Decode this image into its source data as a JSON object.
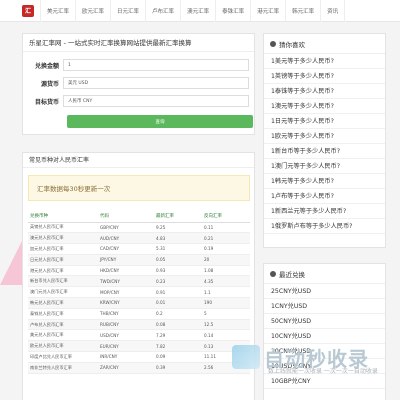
{
  "nav": {
    "logo": "汇",
    "items": [
      "美元汇率",
      "欧元汇率",
      "日元汇率",
      "卢布汇率",
      "澳元汇率",
      "泰铢汇率",
      "港元汇率",
      "韩元汇率",
      "资讯"
    ]
  },
  "converter": {
    "title": "乐星汇率网 - 一站式实时汇率换算网站提供最新汇率换算",
    "amount_label": "兑换金额",
    "amount_value": "1",
    "source_label": "源货币",
    "source_value": "美元 USD",
    "target_label": "目标货币",
    "target_value": "人民币 CNY",
    "button": "查询"
  },
  "rates": {
    "title": "常见币种对人民币汇率",
    "notice": "汇率数据每30秒更新一次",
    "headers": [
      "兑换币种",
      "代码",
      "最新汇率",
      "反向汇率"
    ],
    "rows": [
      [
        "英镑兑人民币汇率",
        "GBP/CNY",
        "9.25",
        "0.11"
      ],
      [
        "澳元兑人民币汇率",
        "AUD/CNY",
        "4.83",
        "0.21"
      ],
      [
        "加元兑人民币汇率",
        "CAD/CNY",
        "5.31",
        "0.19"
      ],
      [
        "日元兑人民币汇率",
        "JPY/CNY",
        "0.05",
        "20"
      ],
      [
        "港元兑人民币汇率",
        "HKD/CNY",
        "0.93",
        "1.08"
      ],
      [
        "新台币兑人民币汇率",
        "TWD/CNY",
        "0.23",
        "4.35"
      ],
      [
        "澳门元兑人民币汇率",
        "MOP/CNY",
        "0.91",
        "1.1"
      ],
      [
        "韩元兑人民币汇率",
        "KRW/CNY",
        "0.01",
        "190"
      ],
      [
        "泰铢兑人民币汇率",
        "THB/CNY",
        "0.2",
        "5"
      ],
      [
        "卢布兑人民币汇率",
        "RUB/CNY",
        "0.08",
        "12.5"
      ],
      [
        "美元兑人民币汇率",
        "USD/CNY",
        "7.29",
        "0.14"
      ],
      [
        "欧元兑人民币汇率",
        "EUR/CNY",
        "7.82",
        "0.13"
      ],
      [
        "印度卢比兑人民币汇率",
        "INR/CNY",
        "0.09",
        "11.11"
      ],
      [
        "南非兰特兑人民币汇率",
        "ZAR/CNY",
        "0.39",
        "2.56"
      ]
    ]
  },
  "sidebar_guess": {
    "title": "猜你喜欢",
    "items": [
      "1美元等于多少人民币?",
      "1英镑等于多少人民币?",
      "1泰铢等于多少人民币?",
      "1澳元等于多少人民币?",
      "1日元等于多少人民币?",
      "1欧元等于多少人民币?",
      "1新台币等于多少人民币?",
      "1澳门元等于多少人民币?",
      "1韩元等于多少人民币?",
      "1卢布等于多少人民币?",
      "1新西兰元等于多少人民币?",
      "1俄罗斯卢布等于多少人民币?"
    ]
  },
  "sidebar_recent": {
    "title": "最近兑换",
    "items": [
      "25CNY兑USD",
      "1CNY兑USD",
      "50CNY兑USD",
      "10CNY兑USD",
      "20CNY兑USD",
      "10USD兑CNY",
      "10GBP兑CNY"
    ]
  },
  "watermark": {
    "text": "自动秒收录",
    "sub": "数上线就能一次收录 一次一次一自动收录"
  }
}
